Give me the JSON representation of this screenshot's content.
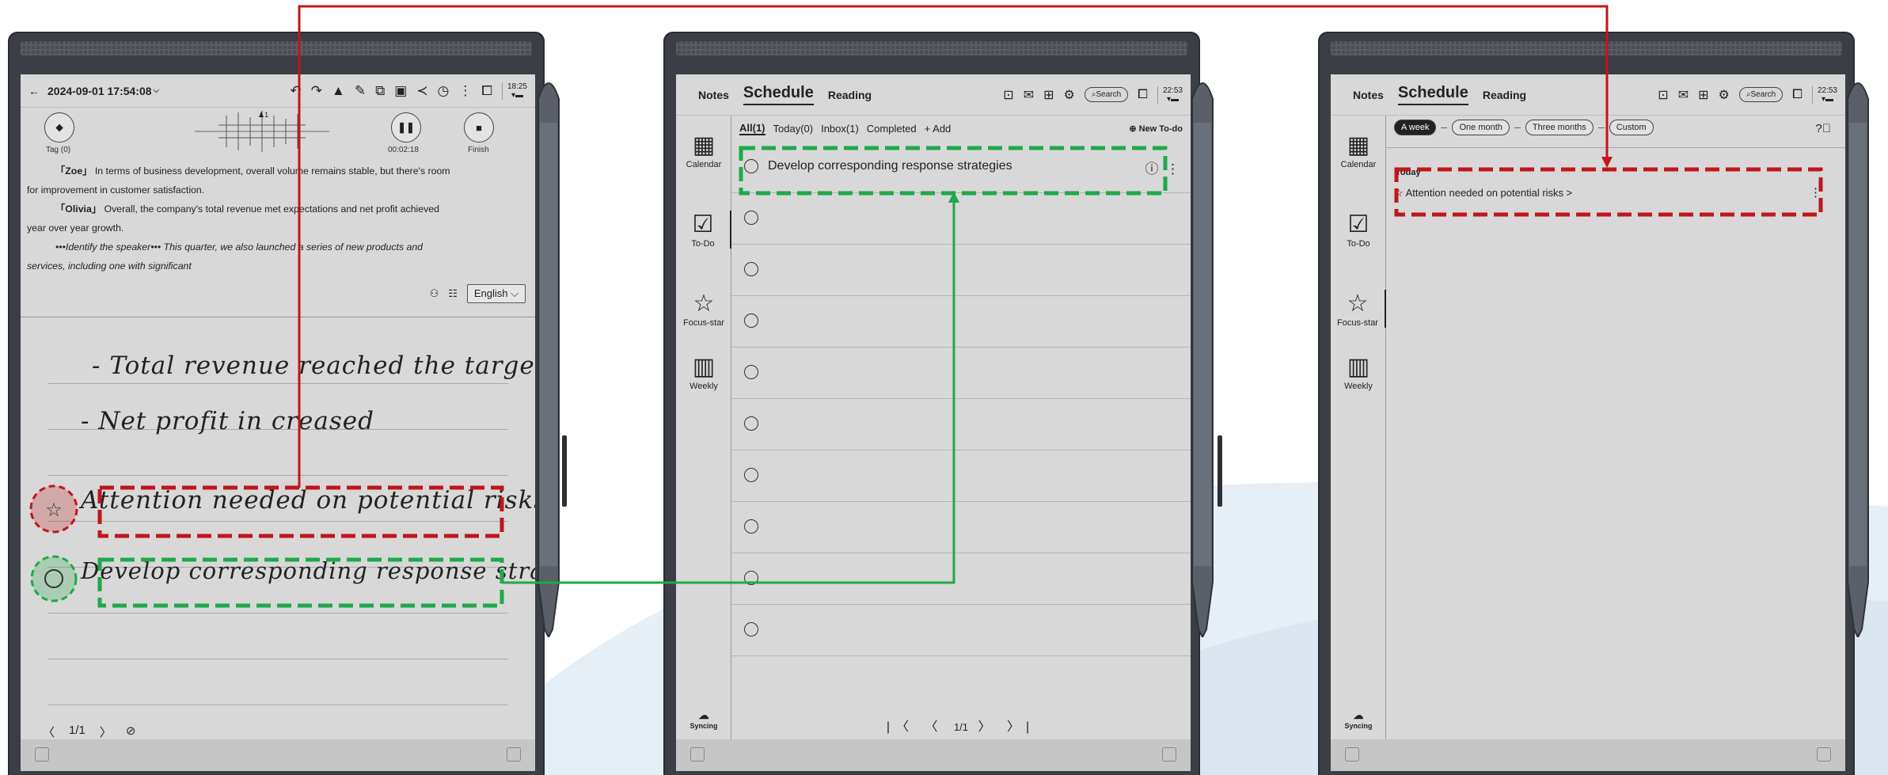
{
  "device1": {
    "datetime": "2024-09-01 17:54:08",
    "status_time": "18:25",
    "recording": {
      "tag_label": "Tag (0)",
      "elapsed": "00:02:18",
      "finish_label": "Finish"
    },
    "transcript": [
      {
        "speaker": "「Zoe」",
        "text": " In terms of business development, overall volume remains stable, but there's room"
      },
      {
        "speaker": "",
        "text": "for improvement in customer satisfaction."
      },
      {
        "speaker": "「Olivia」",
        "text": " Overall, the company's total revenue met expectations and net profit achieved"
      },
      {
        "speaker": "",
        "text": "year over year growth."
      },
      {
        "speaker": "",
        "text": "•••Identify the speaker••• This quarter, we also launched a series of new products and"
      },
      {
        "speaker": "",
        "text": "services, including one with significant"
      }
    ],
    "language": "English",
    "handwriting": [
      "- Total revenue reached the target",
      "- Net profit in creased",
      "Attention needed on potential risks",
      "Develop corresponding response strategies"
    ],
    "page_indicator": "1/1"
  },
  "device2": {
    "status_time": "22:53",
    "nav": {
      "notes": "Notes",
      "schedule": "Schedule",
      "reading": "Reading",
      "search": "Search"
    },
    "sidebar": [
      "Calendar",
      "To-Do",
      "Focus-star",
      "Weekly"
    ],
    "sync_label": "Syncing",
    "filters": {
      "all": "All(1)",
      "today": "Today(0)",
      "inbox": "Inbox(1)",
      "completed": "Completed",
      "add": "+ Add",
      "new": "New To-do"
    },
    "todo_first": "Develop corresponding response strategies",
    "empty_rows": 9,
    "page_indicator": "1/1"
  },
  "device3": {
    "status_time": "22:53",
    "ranges": [
      "A week",
      "One month",
      "Three months",
      "Custom"
    ],
    "today_label": "Today",
    "star_item": "Attention needed on potential risks >"
  },
  "colors": {
    "red": "#c0161c",
    "green": "#1ea94a",
    "screen": "#d8d8d8",
    "bezel": "#3b3e44"
  }
}
